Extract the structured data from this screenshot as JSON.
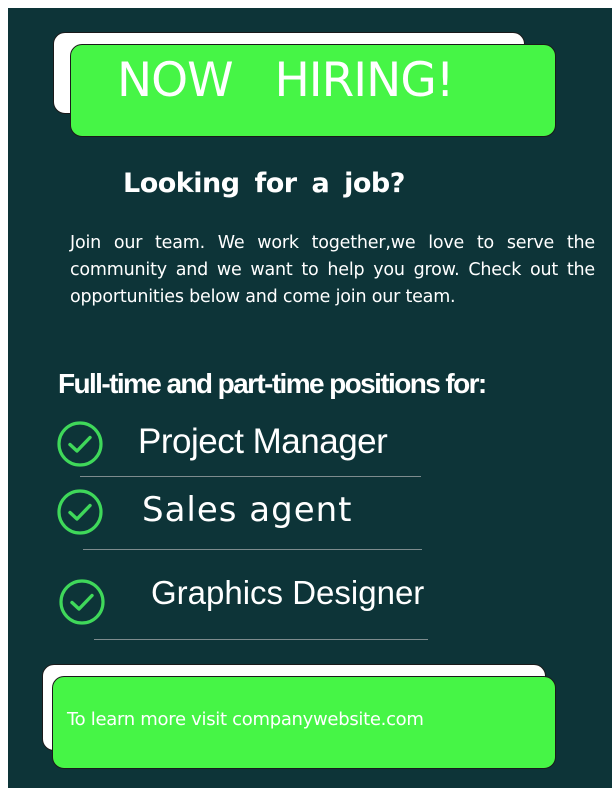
{
  "headline": {
    "text": "NOW   HIRING!"
  },
  "subheading": "Looking  for  a  job?",
  "intro": "Join our team. We work together,we love to serve the community and we want to help you grow. Check out the opportunities below and come join our team.",
  "positions": {
    "title": "Full-time and part-time positions for:",
    "items": [
      {
        "label": "Project Manager",
        "icon": "check-circle-icon"
      },
      {
        "label": "Sales agent",
        "icon": "check-circle-icon"
      },
      {
        "label": "Graphics Designer",
        "icon": "check-circle-icon"
      }
    ]
  },
  "footer": {
    "text": "To learn more visit companywebsite.com"
  },
  "colors": {
    "background": "#0d3438",
    "accent_green": "#46f546",
    "check_green": "#3fd85a",
    "text": "#ffffff"
  }
}
